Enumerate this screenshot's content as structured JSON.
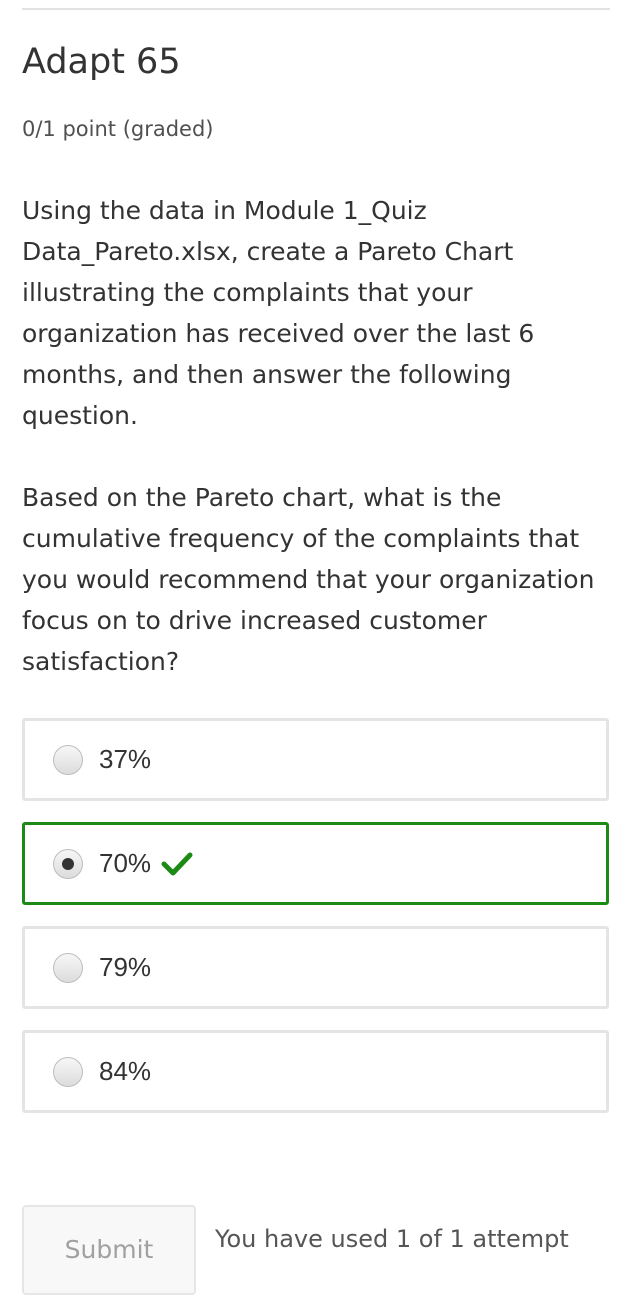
{
  "problem": {
    "title": "Adapt 65",
    "progress": "0/1 point (graded)",
    "paragraphs": [
      "Using the data in Module 1_Quiz Data_Pareto.xlsx, create a Pareto Chart illustrating the complaints that your organization has received over the last 6 months, and then answer the following question.",
      "Based on the Pareto chart, what is the cumulative frequency of the complaints that you would recommend that your organization focus on to drive increased customer satisfaction?"
    ]
  },
  "choices": [
    {
      "label": "37%",
      "selected": false,
      "correct": false
    },
    {
      "label": "70%",
      "selected": true,
      "correct": true
    },
    {
      "label": "79%",
      "selected": false,
      "correct": false
    },
    {
      "label": "84%",
      "selected": false,
      "correct": false
    }
  ],
  "status_icon": "checkmark-icon",
  "colors": {
    "correct_border": "#1d8a16",
    "checkmark": "#1d8a16",
    "choice_border": "#e4e4e4",
    "submit_text": "#a0a0a0"
  },
  "footer": {
    "submit_label": "Submit",
    "submit_disabled": true,
    "attempts_text": "You have used 1 of 1 attempt"
  }
}
